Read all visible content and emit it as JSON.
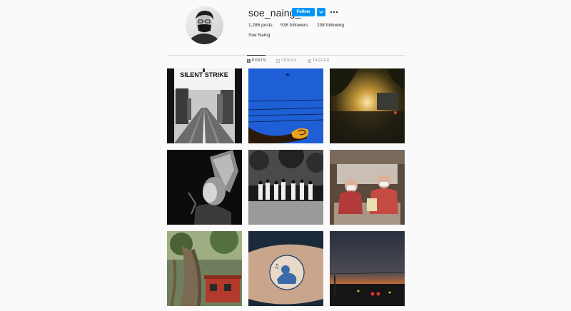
{
  "profile": {
    "username": "soe_naing_11",
    "follow_label": "Follow",
    "posts_count": "1,286",
    "posts_label": "posts",
    "followers_count": "538",
    "followers_label": "followers",
    "following_count": "238",
    "following_label": "following",
    "full_name": "Soe Naing"
  },
  "tabs": [
    {
      "label": "POSTS",
      "icon": "grid-icon",
      "active": true
    },
    {
      "label": "VIDEOS",
      "icon": "video-icon",
      "active": false
    },
    {
      "label": "TAGGED",
      "icon": "tag-icon",
      "active": false
    }
  ],
  "posts": [
    {
      "description": "street-silent-strike",
      "overlay_text": "SILENT STRIKE"
    },
    {
      "description": "blue-sky-power-lines"
    },
    {
      "description": "sunset-through-trees"
    },
    {
      "description": "masked-dancer-portrait"
    },
    {
      "description": "crowd-under-trees"
    },
    {
      "description": "monks-in-vehicle"
    },
    {
      "description": "tree-roots-red-building"
    },
    {
      "description": "tattoo-on-arm"
    },
    {
      "description": "dusk-traffic-lights"
    }
  ],
  "colors": {
    "accent": "#0095f6",
    "text": "#262626",
    "muted": "#8e8e8e",
    "background": "#fafafa"
  }
}
